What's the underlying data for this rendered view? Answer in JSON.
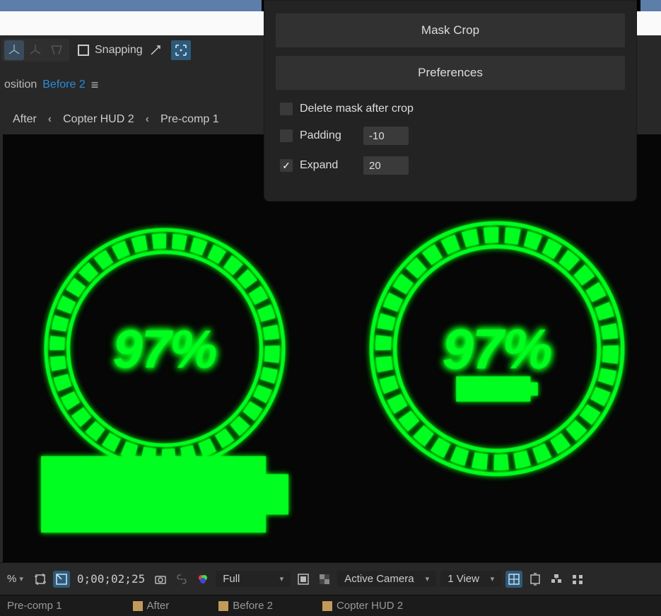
{
  "toolbar": {
    "snapping_label": "Snapping"
  },
  "composition": {
    "prefix_label": "osition",
    "active_name": "Before 2"
  },
  "breadcrumb": [
    {
      "label": "After"
    },
    {
      "label": "Copter HUD 2"
    },
    {
      "label": "Pre-comp 1"
    }
  ],
  "panel": {
    "mask_crop_label": "Mask Crop",
    "preferences_label": "Preferences",
    "delete_mask_label": "Delete mask after crop",
    "padding_label": "Padding",
    "padding_value": "-10",
    "expand_label": "Expand",
    "expand_value": "20",
    "delete_mask_checked": false,
    "padding_checked": false,
    "expand_checked": true
  },
  "hud": {
    "percent_text": "97%"
  },
  "bottom": {
    "zoom_suffix": "%",
    "timecode": "0;00;02;25",
    "resolution": "Full",
    "camera": "Active Camera",
    "view_count": "1 View"
  },
  "timeline": {
    "items": [
      {
        "label": "Pre-comp 1"
      },
      {
        "label": "After"
      },
      {
        "label": "Before 2"
      },
      {
        "label": "Copter HUD 2"
      }
    ]
  },
  "icons": {
    "axis": "axis-icon",
    "axis2": "axis-icon",
    "anchor": "anchor-icon",
    "angle": "angle-icon",
    "expand_grid": "expand-grid-icon",
    "menu": "menu-icon",
    "chev": "chevron-left-icon",
    "crop": "crop-icon",
    "region": "region-icon",
    "camera_i": "camera-icon",
    "link": "link-icon",
    "aperture": "aperture-icon",
    "mask": "mask-icon",
    "trans": "transparency-grid-icon",
    "guides": "guides-icon",
    "snap_comp": "snap-icon",
    "flow": "flowchart-icon",
    "reveal": "reveal-icon"
  }
}
